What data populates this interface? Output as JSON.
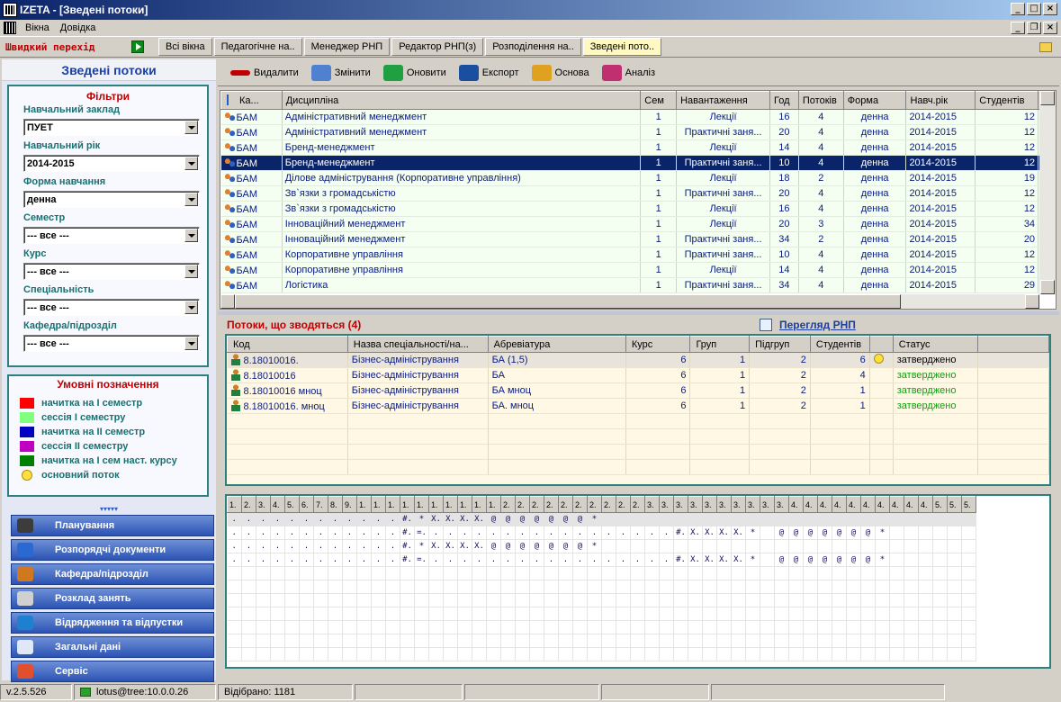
{
  "window": {
    "title": "IZETA - [Зведені потоки]"
  },
  "menu": {
    "items": [
      "Вікна",
      "Довідка"
    ]
  },
  "quicknav": {
    "label": "Швидкий перехід",
    "tabs": [
      "Всі вікна",
      "Педагогічне на..",
      "Менеджер РНП",
      "Редактор РНП(з)",
      "Розподілення на..",
      "Зведені пото.."
    ],
    "active_index": 5
  },
  "left": {
    "title": "Зведені потоки",
    "filters_title": "Фільтри",
    "filters": [
      {
        "label": "Навчальний заклад",
        "value": "ПУЕТ"
      },
      {
        "label": "Навчальний рік",
        "value": "2014-2015"
      },
      {
        "label": "Форма навчання",
        "value": "денна"
      },
      {
        "label": "Семестр",
        "value": "--- все ---"
      },
      {
        "label": "Курс",
        "value": "--- все ---"
      },
      {
        "label": "Спеціальність",
        "value": "--- все ---"
      },
      {
        "label": "Кафедра/підрозділ",
        "value": "--- все ---"
      }
    ],
    "legend_title": "Умовні позначення",
    "legend": [
      {
        "label": "начитка на І семестр",
        "color": "#ff0000"
      },
      {
        "label": "сессія І семестру",
        "color": "#80ff80"
      },
      {
        "label": "начитка на ІІ семестр",
        "color": "#0000c0"
      },
      {
        "label": "сессія ІІ семестру",
        "color": "#c000c0"
      },
      {
        "label": "начитка на І сем наст. курсу",
        "color": "#008000"
      },
      {
        "label": "основний поток",
        "color": "bulb"
      }
    ],
    "chevrons": "▾▾▾▾▾",
    "nav": [
      {
        "label": "Планування",
        "icon": "graduation-cap-icon",
        "color": "#3c3c3c"
      },
      {
        "label": "Розпорядчі документи",
        "icon": "documents-icon",
        "color": "#2a6ad0"
      },
      {
        "label": "Кафедра/підрозділ",
        "icon": "briefcase-icon",
        "color": "#d07820"
      },
      {
        "label": "Розклад занять",
        "icon": "clock-icon",
        "color": "#d0d0d0"
      },
      {
        "label": "Відрядження та відпустки",
        "icon": "globe-icon",
        "color": "#2080d0"
      },
      {
        "label": "Загальні дані",
        "icon": "form-icon",
        "color": "#e0e8f8"
      },
      {
        "label": "Сервіс",
        "icon": "calendar-icon",
        "color": "#e05030"
      }
    ]
  },
  "toolbar": [
    {
      "label": "Видалити",
      "icon": "delete-icon",
      "color": "#c00000"
    },
    {
      "label": "Змінити",
      "icon": "edit-icon",
      "color": "#5080d0"
    },
    {
      "label": "Оновити",
      "icon": "refresh-icon",
      "color": "#20a040"
    },
    {
      "label": "Експорт",
      "icon": "word-icon",
      "color": "#1a4fa0"
    },
    {
      "label": "Основа",
      "icon": "pencil-icon",
      "color": "#e0a020"
    },
    {
      "label": "Аналіз",
      "icon": "people-icon",
      "color": "#c03070"
    }
  ],
  "disciplines": {
    "columns": [
      "Ка...",
      "Дисципліна",
      "Сем",
      "Навантаження",
      "Год",
      "Потоків",
      "Форма",
      "Навч.рік",
      "Студентів"
    ],
    "selected_index": 3,
    "rows": [
      [
        "БАМ",
        "Адміністративний менеджмент",
        "1",
        "Лекції",
        "16",
        "4",
        "денна",
        "2014-2015",
        "12"
      ],
      [
        "БАМ",
        "Адміністративний менеджмент",
        "1",
        "Практичні заня...",
        "20",
        "4",
        "денна",
        "2014-2015",
        "12"
      ],
      [
        "БАМ",
        "Бренд-менеджмент",
        "1",
        "Лекції",
        "14",
        "4",
        "денна",
        "2014-2015",
        "12"
      ],
      [
        "БАМ",
        "Бренд-менеджмент",
        "1",
        "Практичні заня...",
        "10",
        "4",
        "денна",
        "2014-2015",
        "12"
      ],
      [
        "БАМ",
        "Ділове адміністрування (Корпоративне управління)",
        "1",
        "Лекції",
        "18",
        "2",
        "денна",
        "2014-2015",
        "19"
      ],
      [
        "БАМ",
        "Зв`язки з громадськістю",
        "1",
        "Практичні заня...",
        "20",
        "4",
        "денна",
        "2014-2015",
        "12"
      ],
      [
        "БАМ",
        "Зв`язки з громадськістю",
        "1",
        "Лекції",
        "16",
        "4",
        "денна",
        "2014-2015",
        "12"
      ],
      [
        "БАМ",
        "Інноваційний менеджмент",
        "1",
        "Лекції",
        "20",
        "3",
        "денна",
        "2014-2015",
        "34"
      ],
      [
        "БАМ",
        "Інноваційний менеджмент",
        "1",
        "Практичні заня...",
        "34",
        "2",
        "денна",
        "2014-2015",
        "20"
      ],
      [
        "БАМ",
        "Корпоративне управління",
        "1",
        "Практичні заня...",
        "10",
        "4",
        "денна",
        "2014-2015",
        "12"
      ],
      [
        "БАМ",
        "Корпоративне управління",
        "1",
        "Лекції",
        "14",
        "4",
        "денна",
        "2014-2015",
        "12"
      ],
      [
        "БАМ",
        "Логістика",
        "1",
        "Практичні заня...",
        "34",
        "4",
        "денна",
        "2014-2015",
        "29"
      ]
    ]
  },
  "streams": {
    "title": "Потоки, що зводяться (4)",
    "link": "Перегляд РНП",
    "columns": [
      "Код",
      "Назва спеціальності/на...",
      "Абревіатура",
      "Курс",
      "Груп",
      "Підгруп",
      "Студентів",
      "",
      "Статус"
    ],
    "rows": [
      [
        "8.18010016.",
        "Бізнес-адміністрування",
        "БА (1,5)",
        "6",
        "1",
        "2",
        "6",
        "bulb",
        "затверджено"
      ],
      [
        "8.18010016",
        "Бізнес-адміністрування",
        "БА",
        "6",
        "1",
        "2",
        "4",
        "",
        "затверджено"
      ],
      [
        "8.18010016 мноц",
        "Бізнес-адміністрування",
        "БА мноц",
        "6",
        "1",
        "2",
        "1",
        "",
        "затверджено"
      ],
      [
        "8.18010016. мноц",
        "Бізнес-адміністрування",
        "БА. мноц",
        "6",
        "1",
        "2",
        "1",
        "",
        "затверджено"
      ]
    ]
  },
  "schedule": {
    "headers": [
      "1.",
      "2.",
      "3.",
      "4.",
      "5.",
      "6.",
      "7.",
      "8.",
      "9.",
      "1.",
      "1.",
      "1.",
      "1.",
      "1.",
      "1.",
      "1.",
      "1.",
      "1.",
      "1.",
      "2.",
      "2.",
      "2.",
      "2.",
      "2.",
      "2.",
      "2.",
      "2.",
      "2.",
      "2.",
      "3.",
      "3.",
      "3.",
      "3.",
      "3.",
      "3.",
      "3.",
      "3.",
      "3.",
      "3.",
      "4.",
      "4.",
      "4.",
      "4.",
      "4.",
      "4.",
      "4.",
      "4.",
      "4.",
      "4.",
      "5.",
      "5.",
      "5."
    ],
    "rows": [
      ".,.,.,.,.,.,.,.,.,.,.,.,#.,*,X.,X.,X.,X.,@,@,@,@,@,@,@,*",
      ".,.,.,.,.,.,.,.,.,.,.,.,#.,=.,.,.,.,.,.,.,.,.,.,.,.,.,.,.,.,.,.,#.,X.,X.,X.,X.,*,,@,@,@,@,@,@,@,*",
      ".,.,.,.,.,.,.,.,.,.,.,.,#.,*,X.,X.,X.,X.,@,@,@,@,@,@,@,*",
      ".,.,.,.,.,.,.,.,.,.,.,.,#.,=.,.,.,.,.,.,.,.,.,.,.,.,.,.,.,.,.,.,#.,X.,X.,X.,X.,*,,@,@,@,@,@,@,@,*"
    ]
  },
  "status": {
    "version": "v.2.5.526",
    "connection": "lotus@tree:10.0.0.26",
    "selected": "Відібрано: 1181"
  }
}
